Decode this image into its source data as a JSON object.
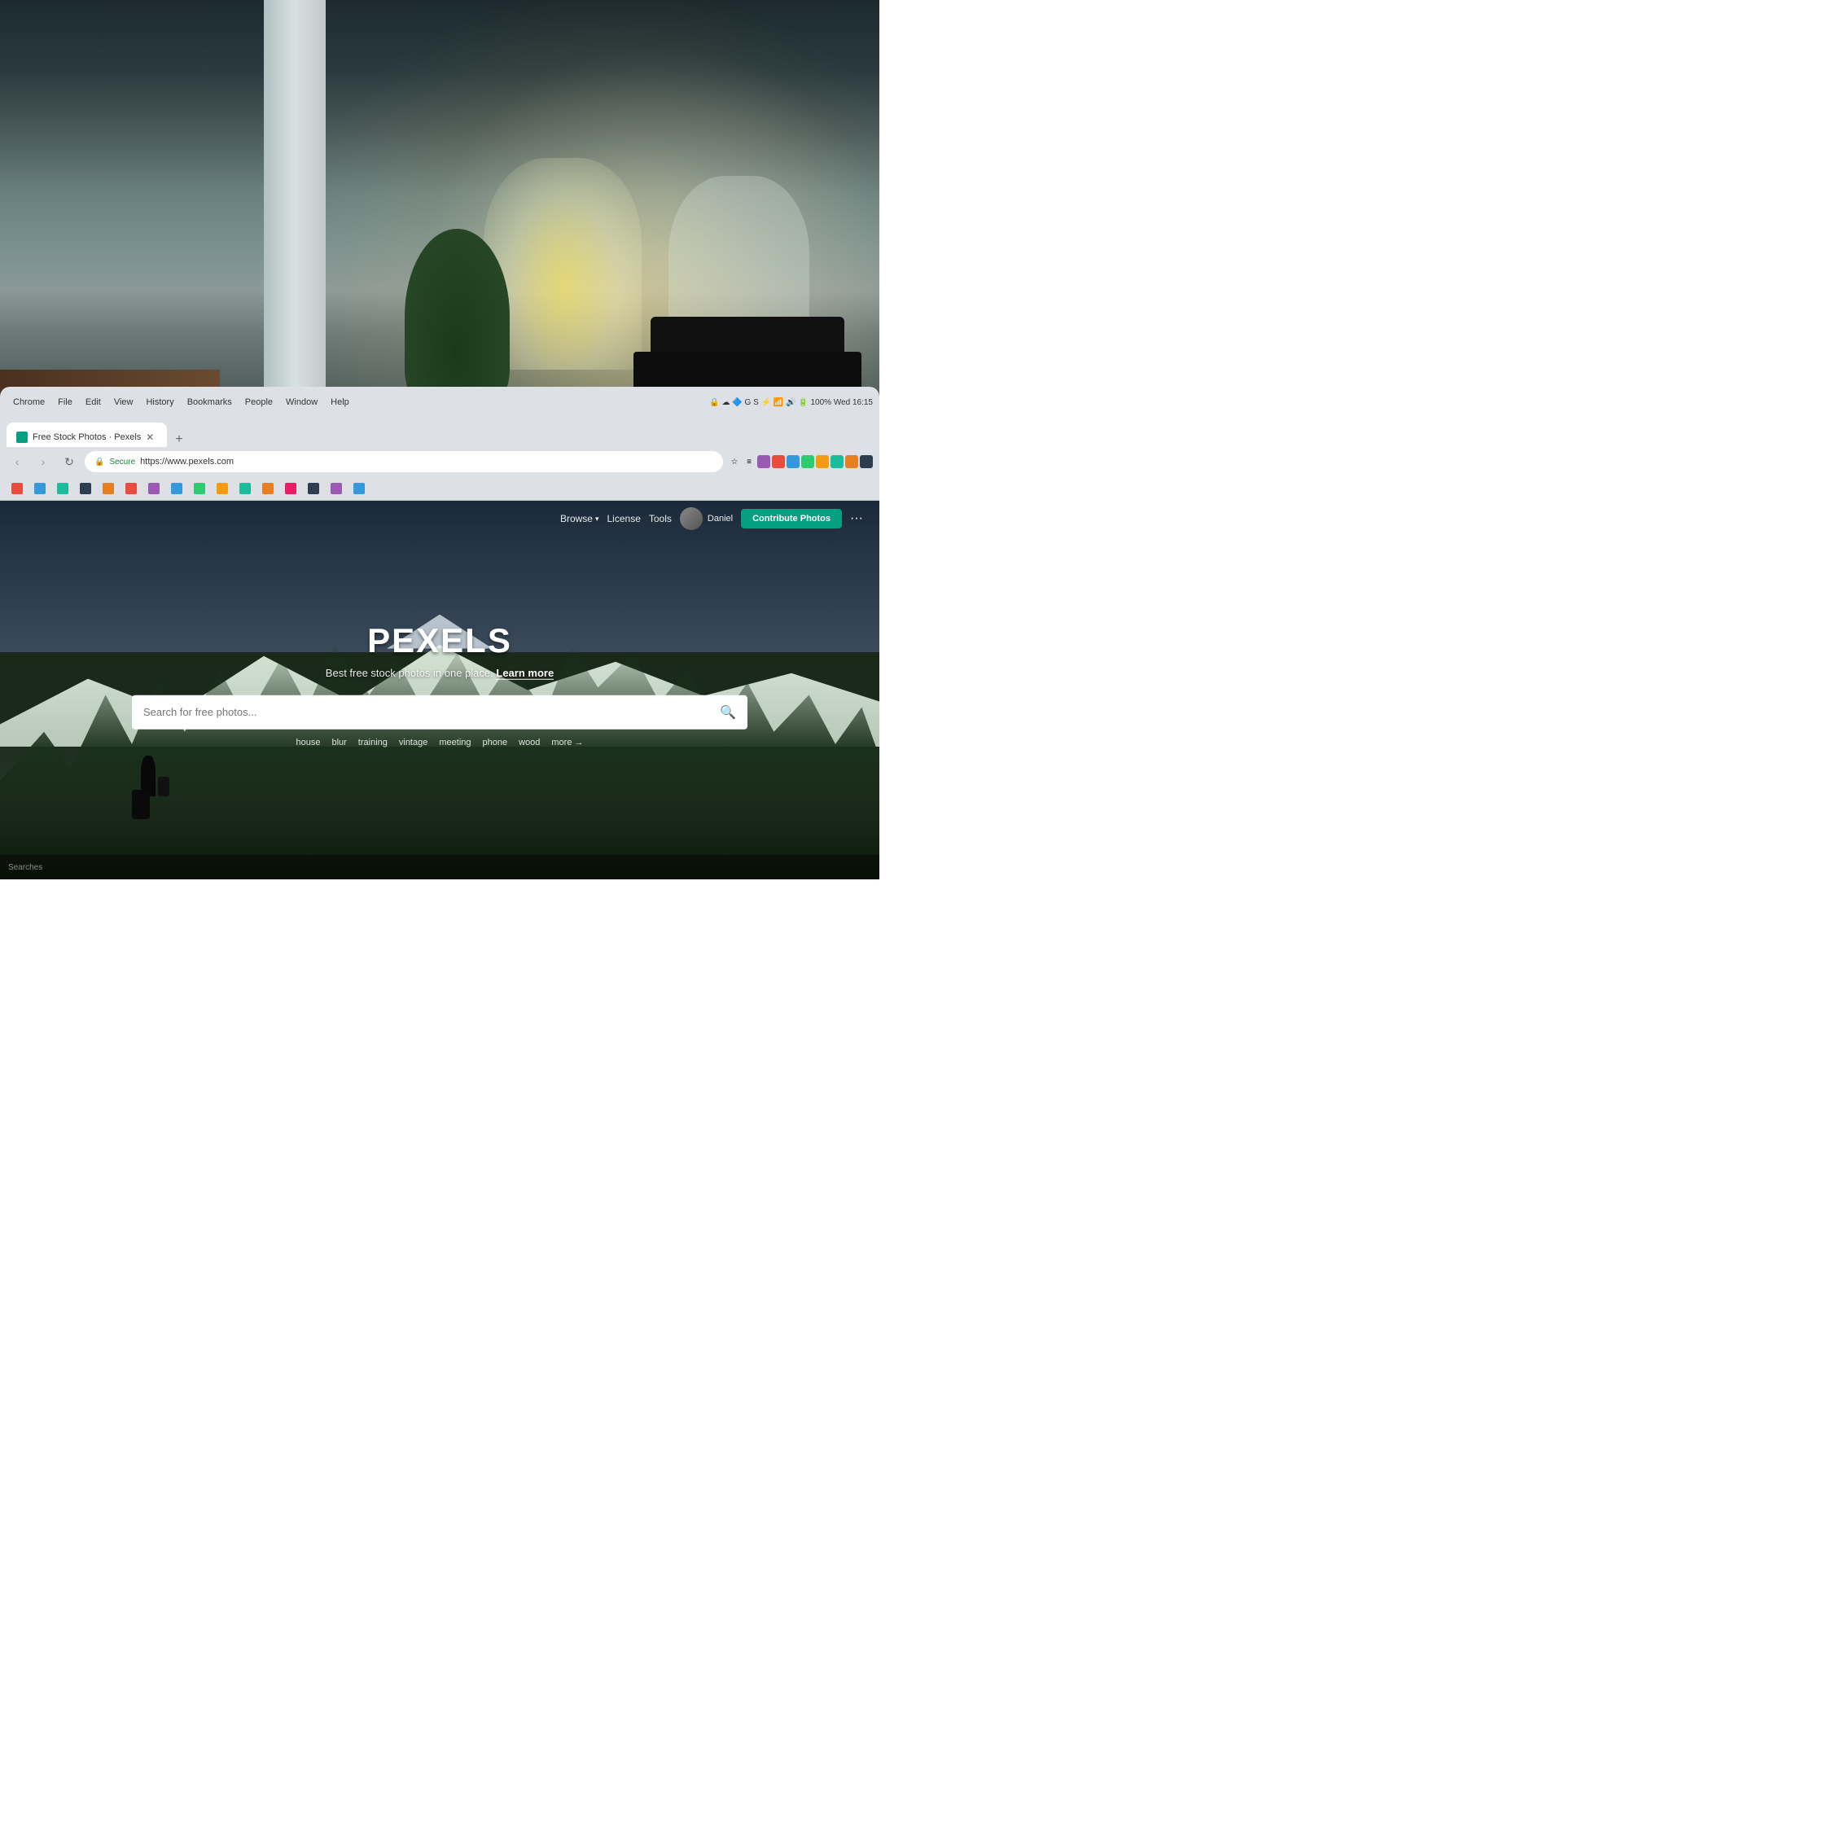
{
  "background": {
    "description": "Office interior background photo"
  },
  "chrome_bar": {
    "menu_items": [
      "Chrome",
      "File",
      "Edit",
      "View",
      "History",
      "Bookmarks",
      "People",
      "Window",
      "Help"
    ],
    "system_info": "Wed 16:15",
    "battery": "100%",
    "wifi_icon": "wifi",
    "volume_icon": "volume",
    "power_icon": "power"
  },
  "tab": {
    "title": "Free Stock Photos · Pexels",
    "favicon_color": "#05a081"
  },
  "address_bar": {
    "secure_label": "Secure",
    "url": "https://www.pexels.com"
  },
  "bookmarks": [
    {
      "label": "",
      "color": "#e74c3c"
    },
    {
      "label": "",
      "color": "#3498db"
    },
    {
      "label": "",
      "color": "#2ecc71"
    },
    {
      "label": "",
      "color": "#f39c12"
    },
    {
      "label": "",
      "color": "#9b59b6"
    },
    {
      "label": "",
      "color": "#1abc9c"
    },
    {
      "label": "",
      "color": "#e67e22"
    },
    {
      "label": "",
      "color": "#2c3e50"
    },
    {
      "label": "",
      "color": "#e91e63"
    },
    {
      "label": "",
      "color": "#3498db"
    },
    {
      "label": "",
      "color": "#e74c3c"
    },
    {
      "label": "",
      "color": "#2ecc71"
    },
    {
      "label": "",
      "color": "#f39c12"
    },
    {
      "label": "",
      "color": "#9b59b6"
    },
    {
      "label": "",
      "color": "#1abc9c"
    },
    {
      "label": "",
      "color": "#e67e22"
    },
    {
      "label": "",
      "color": "#2c3e50"
    }
  ],
  "pexels": {
    "nav": {
      "browse_label": "Browse",
      "license_label": "License",
      "tools_label": "Tools",
      "user_name": "Daniel",
      "contribute_label": "Contribute Photos",
      "more_label": "···"
    },
    "hero": {
      "title": "PEXELS",
      "subtitle": "Best free stock photos in one place.",
      "learn_more_label": "Learn more",
      "search_placeholder": "Search for free photos...",
      "tags": [
        "house",
        "blur",
        "training",
        "vintage",
        "meeting",
        "phone",
        "wood"
      ],
      "more_label": "more →"
    }
  },
  "bottom_bar": {
    "searches_label": "Searches"
  }
}
